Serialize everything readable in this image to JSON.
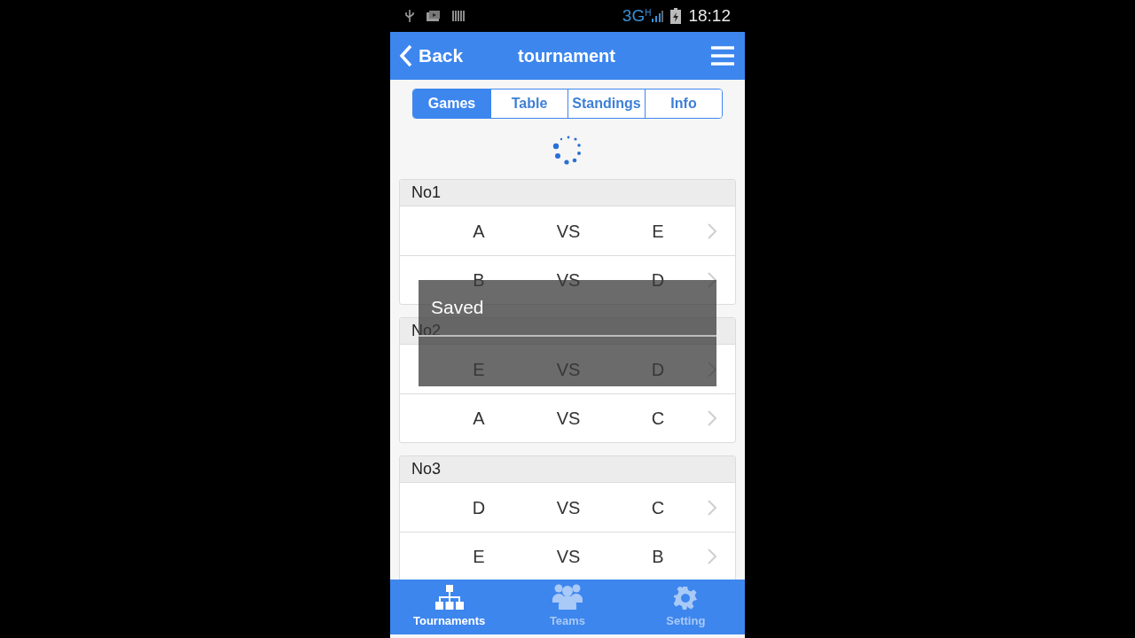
{
  "status_bar": {
    "network": "3G",
    "network_sub": "H",
    "time": "18:12"
  },
  "header": {
    "back": "Back",
    "title": "tournament"
  },
  "tabs": [
    {
      "label": "Games",
      "selected": true
    },
    {
      "label": "Table",
      "selected": false
    },
    {
      "label": "Standings",
      "selected": false
    },
    {
      "label": "Info",
      "selected": false
    }
  ],
  "groups": [
    {
      "title": "No1",
      "games": [
        {
          "home": "A",
          "vs": "VS",
          "away": "E"
        },
        {
          "home": "B",
          "vs": "VS",
          "away": "D"
        }
      ]
    },
    {
      "title": "No2",
      "games": [
        {
          "home": "E",
          "vs": "VS",
          "away": "D"
        },
        {
          "home": "A",
          "vs": "VS",
          "away": "C"
        }
      ]
    },
    {
      "title": "No3",
      "games": [
        {
          "home": "D",
          "vs": "VS",
          "away": "C"
        },
        {
          "home": "E",
          "vs": "VS",
          "away": "B"
        }
      ]
    }
  ],
  "toast": {
    "message": "Saved"
  },
  "bottom_nav": [
    {
      "label": "Tournaments",
      "selected": true
    },
    {
      "label": "Teams",
      "selected": false
    },
    {
      "label": "Setting",
      "selected": false
    }
  ]
}
